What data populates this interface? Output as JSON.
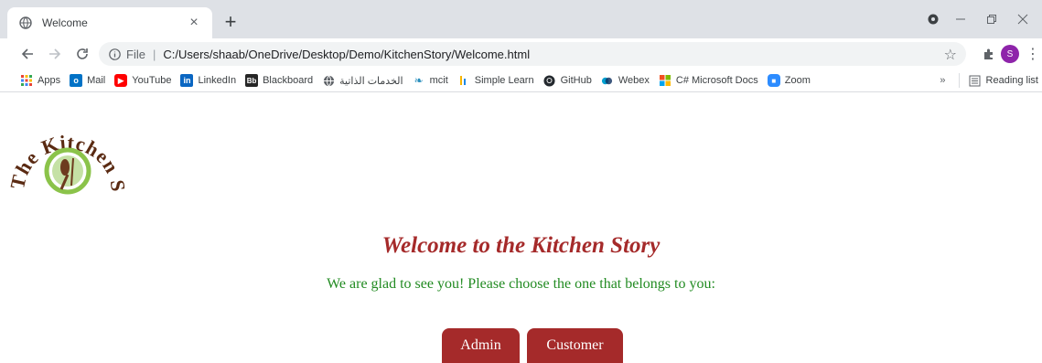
{
  "browser": {
    "tab_title": "Welcome",
    "tab_close": "×",
    "new_tab": "+",
    "address_scheme_label": "File",
    "address_url": "C:/Users/shaab/OneDrive/Desktop/Demo/KitchenStory/Welcome.html",
    "avatar_letter": "S",
    "bookmarks": [
      {
        "label": "Apps",
        "icon": "apps-grid-icon"
      },
      {
        "label": "Mail",
        "icon": "outlook-icon"
      },
      {
        "label": "YouTube",
        "icon": "youtube-icon"
      },
      {
        "label": "LinkedIn",
        "icon": "linkedin-icon"
      },
      {
        "label": "Blackboard",
        "icon": "blackboard-icon"
      },
      {
        "label": "الخدمات الذاتية",
        "icon": "globe-icon"
      },
      {
        "label": "mcit",
        "icon": "mcit-icon"
      },
      {
        "label": "Simple Learn",
        "icon": "simplelearn-icon"
      },
      {
        "label": "GitHub",
        "icon": "github-icon"
      },
      {
        "label": "Webex",
        "icon": "webex-icon"
      },
      {
        "label": "C# Microsoft Docs",
        "icon": "microsoft-icon"
      },
      {
        "label": "Zoom",
        "icon": "zoom-icon"
      }
    ],
    "overflow": "»",
    "reading_list": "Reading list"
  },
  "page": {
    "logo_text_arc": "The Kitchen Story",
    "title": "Welcome to the Kitchen Story",
    "subtitle": "We are glad to see you! Please choose the one that belongs to you:",
    "buttons": {
      "admin": "Admin",
      "customer": "Customer"
    }
  },
  "colors": {
    "title": "#a52a2a",
    "subtitle": "#228b22",
    "button_bg": "#a52a2a",
    "button_text": "#ffffff"
  }
}
